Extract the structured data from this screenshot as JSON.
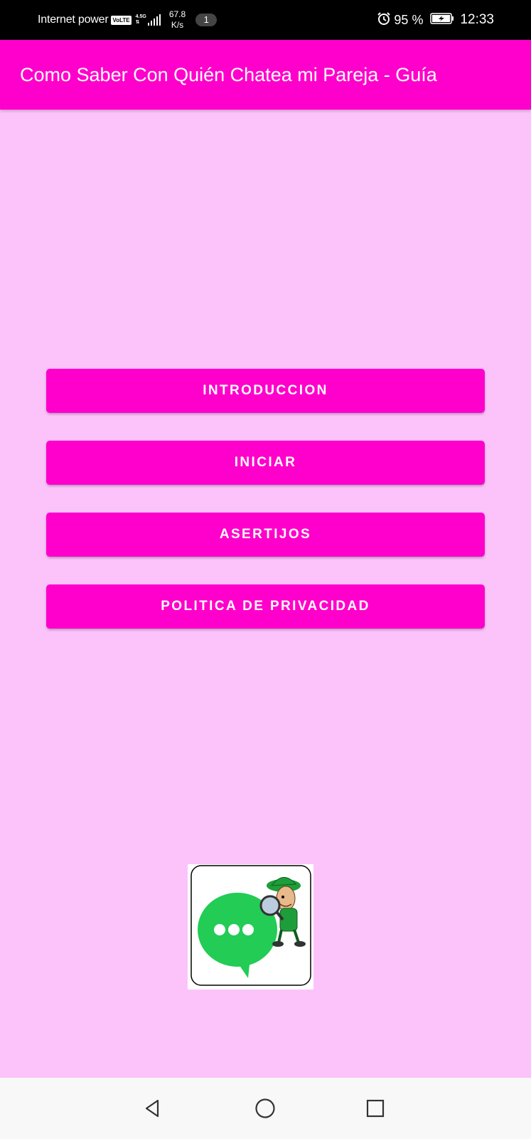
{
  "status_bar": {
    "carrier": "Internet power",
    "volte": "VoLTE",
    "network_type": "4.5G",
    "speed_value": "67.8",
    "speed_unit": "K/s",
    "notification_count": "1",
    "battery_percent": "95 %",
    "time": "12:33",
    "icons": [
      "signal-icon",
      "alarm-icon",
      "battery-charging-icon"
    ]
  },
  "app_bar": {
    "title": "Como Saber Con Quién Chatea mi Pareja - Guía"
  },
  "menu": {
    "buttons": [
      {
        "label": "INTRODUCCION"
      },
      {
        "label": "INICIAR"
      },
      {
        "label": "ASERTIJOS"
      },
      {
        "label": "POLITICA DE PRIVACIDAD"
      }
    ]
  },
  "logo": {
    "icon": "chat-detective-logo-icon"
  },
  "nav_bar": {
    "icons": [
      "back-icon",
      "home-icon",
      "recents-icon"
    ]
  },
  "colors": {
    "primary": "#FF00CC",
    "background": "#FCC3FB",
    "status_bar": "#000000",
    "nav_bar": "#F8F8F8",
    "logo_green": "#22CC55"
  }
}
